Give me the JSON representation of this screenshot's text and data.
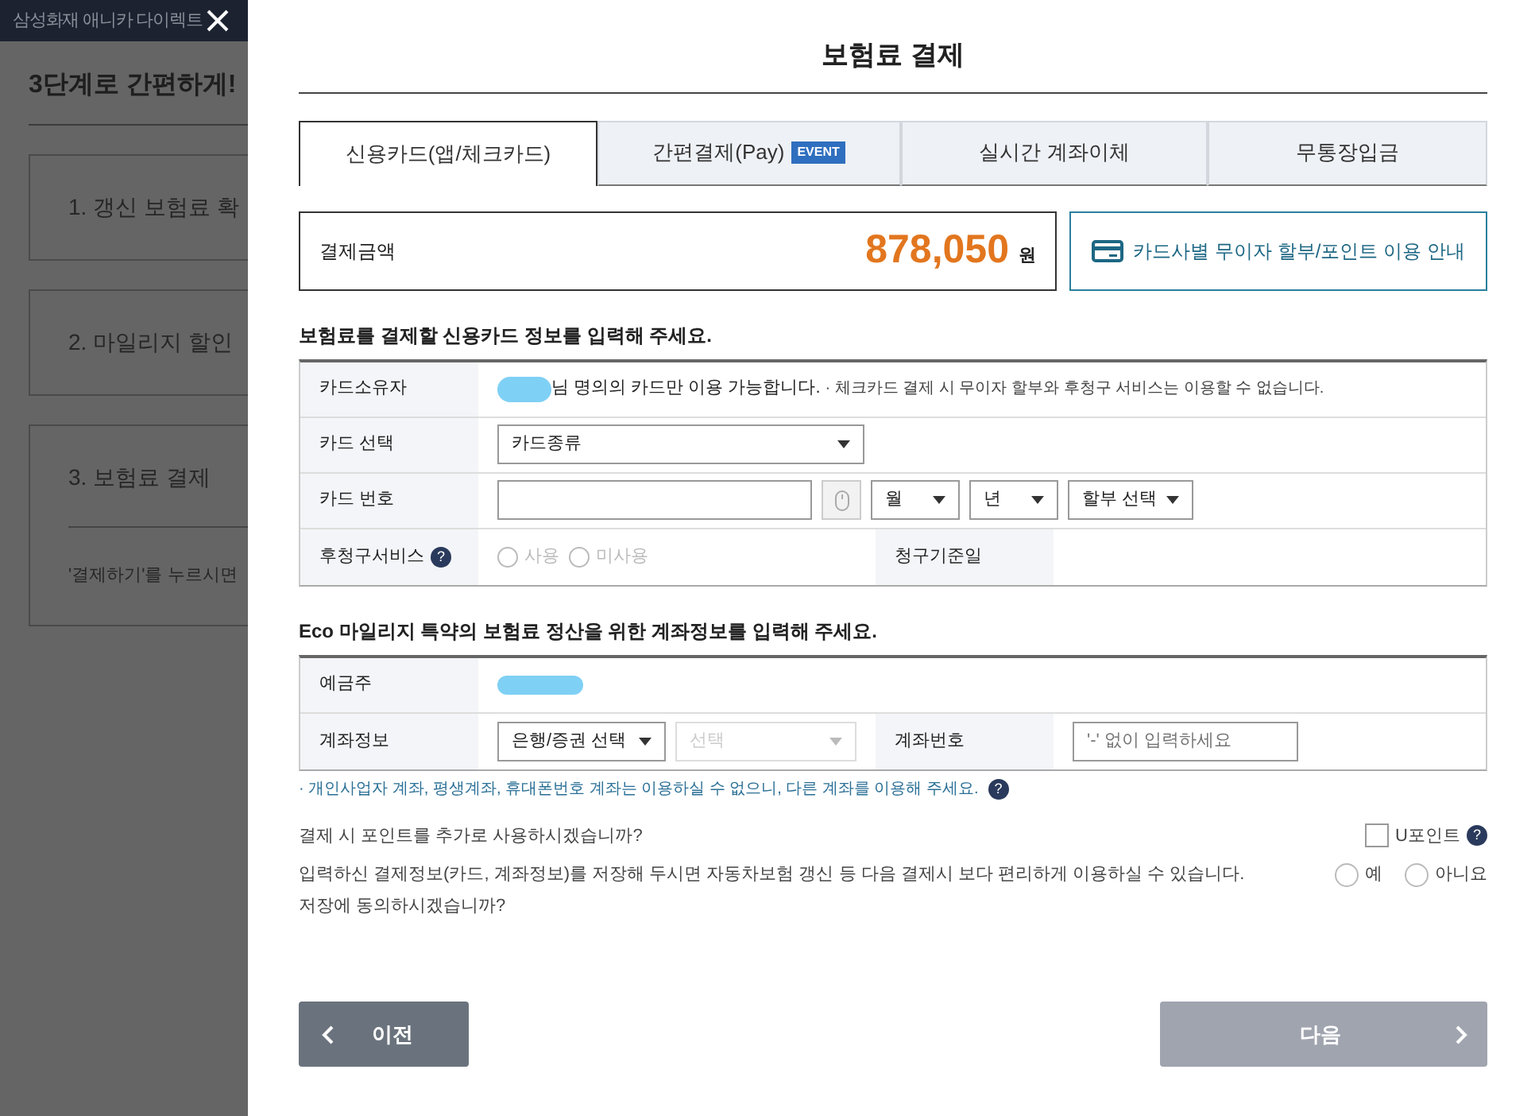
{
  "background_page": {
    "header_title": "삼성화재 애니카 다이렉트",
    "heading": "3단계로 간편하게!",
    "steps": [
      {
        "label": "1. 갱신 보험료 확"
      },
      {
        "label": "2. 마일리지 할인"
      },
      {
        "label": "3. 보험료 결제",
        "note": "'결제하기'를 누르시면"
      }
    ]
  },
  "modal": {
    "title": "보험료 결제",
    "tabs": [
      {
        "label": "신용카드(앱/체크카드)",
        "selected": true
      },
      {
        "label": "간편결제(Pay)",
        "badge": "EVENT",
        "selected": false
      },
      {
        "label": "실시간 계좌이체",
        "selected": false
      },
      {
        "label": "무통장입금",
        "selected": false
      }
    ],
    "amount": {
      "label": "결제금액",
      "value": "878,050",
      "unit": "원"
    },
    "installment_info_button": "카드사별 무이자 할부/포인트 이용 안내",
    "card_section": {
      "heading": "보험료를 결제할 신용카드 정보를 입력해 주세요.",
      "owner": {
        "label": "카드소유자",
        "text": "님 명의의 카드만 이용 가능합니다.",
        "note": "· 체크카드 결제 시 무이자 할부와 후청구 서비스는 이용할 수 없습니다."
      },
      "card_select": {
        "label": "카드 선택",
        "value": "카드종류"
      },
      "card_number": {
        "label": "카드 번호",
        "month": "월",
        "year": "년",
        "installment": "할부 선택"
      },
      "deferred": {
        "label": "후청구서비스",
        "help": "?",
        "disabled": true,
        "billing_label": "청구기준일",
        "options": [
          {
            "label": "사용",
            "selected": false
          },
          {
            "label": "미사용",
            "selected": false
          }
        ]
      }
    },
    "account_section": {
      "heading": "Eco 마일리지 특약의 보험료 정산을 위한 계좌정보를 입력해 주세요.",
      "holder_label": "예금주",
      "info_label": "계좌정보",
      "bank": "은행/증권 선택",
      "branch": "선택",
      "branch_disabled": true,
      "number_label": "계좌번호",
      "number_placeholder": "'-' 없이 입력하세요",
      "notice": "· 개인사업자 계좌, 평생계좌, 휴대폰번호 계좌는 이용하실 수 없으니, 다른 계좌를 이용해 주세요.",
      "notice_help": "?"
    },
    "points": {
      "question": "결제 시 포인트를 추가로 사용하시겠습니까?",
      "checkbox": {
        "label": "U포인트",
        "checked": false
      },
      "help": "?"
    },
    "consent": {
      "text": "입력하신 결제정보(카드, 계좌정보)를 저장해 두시면 자동차보험 갱신 등 다음 결제시 보다 편리하게 이용하실 수 있습니다.",
      "question": "저장에 동의하시겠습니까?",
      "options": [
        {
          "label": "예",
          "selected": false
        },
        {
          "label": "아니요",
          "selected": false
        }
      ]
    },
    "buttons": [
      {
        "label": "이전",
        "kind": "prev",
        "disabled": false
      },
      {
        "label": "다음",
        "kind": "next",
        "disabled": true
      }
    ]
  }
}
